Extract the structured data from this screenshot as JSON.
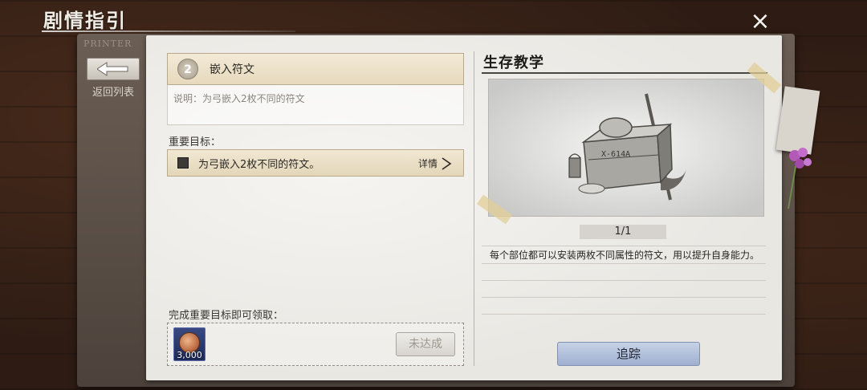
{
  "header": {
    "title": "剧情指引",
    "close_icon": "×"
  },
  "sidebar": {
    "folder_stamp": "PRINTER",
    "back_label": "返回列表"
  },
  "quest": {
    "number": "2",
    "title": "嵌入符文",
    "description": "说明：为弓嵌入2枚不同的符文"
  },
  "goals": {
    "label": "重要目标：",
    "items": [
      {
        "text": "为弓嵌入2枚不同的符文。",
        "detail_label": "详情"
      }
    ]
  },
  "reward": {
    "label": "完成重要目标即可领取：",
    "amount": "3,000",
    "icon": "copper-coin-icon",
    "status_button": "未达成"
  },
  "tutorial": {
    "title": "生存教学",
    "photo_caption": "X-614A",
    "page_indicator": "1/1",
    "tip": "每个部位都可以安装两枚不同属性的符文，用以提升自身能力。",
    "track_button": "追踪"
  },
  "colors": {
    "quest_highlight": "#e6d9bd",
    "track_button": "#9fb0cf",
    "reward_bg": "#1e2a58"
  }
}
